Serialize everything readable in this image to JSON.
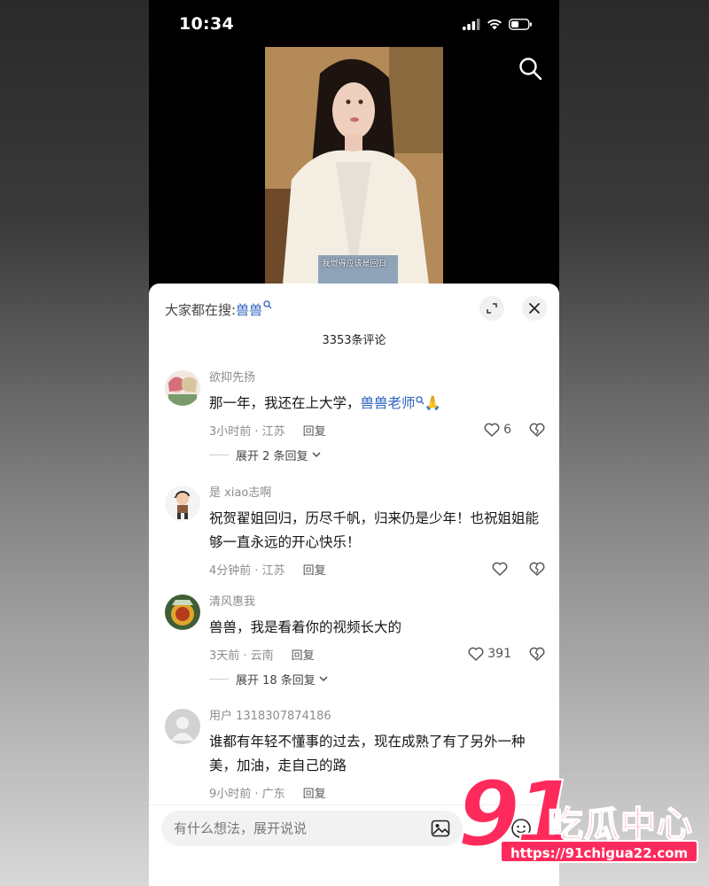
{
  "status_bar": {
    "time": "10:34"
  },
  "video": {
    "subtitle": "我觉得应该是回归"
  },
  "sheet": {
    "trending_prefix": "大家都在搜:",
    "trending_term": "兽兽",
    "comment_count": "3353条评论"
  },
  "comments": [
    {
      "username": "欲抑先扬",
      "text_before": "那一年，我还在上大学，",
      "mention": "兽兽老师",
      "emoji": "🙏",
      "time_location": "3小时前 · 江苏",
      "reply_label": "回复",
      "likes": "6",
      "expand_label": "展开 2 条回复"
    },
    {
      "username": "是 xiao志啊",
      "text": "祝贺翟姐回归，历尽千帆，归来仍是少年！也祝姐姐能够一直永远的开心快乐！",
      "time_location": "4分钟前 · 江苏",
      "reply_label": "回复",
      "likes": ""
    },
    {
      "username": "清风惠我",
      "text": "兽兽，我是看着你的视频长大的",
      "time_location": "3天前 · 云南",
      "reply_label": "回复",
      "likes": "391",
      "expand_label": "展开 18 条回复"
    },
    {
      "username": "用户 1318307874186",
      "text": "谁都有年轻不懂事的过去，现在成熟了有了另外一种美，加油，走自己的路",
      "time_location": "9小时前 · 广东",
      "reply_label": "回复"
    }
  ],
  "input": {
    "placeholder": "有什么想法，展开说说"
  },
  "watermark": {
    "number": "91",
    "brand": "吃瓜中心",
    "url": "https://91chigua22.com"
  },
  "colors": {
    "mention": "#2b62c0",
    "watermark": "#ff2a5c"
  }
}
